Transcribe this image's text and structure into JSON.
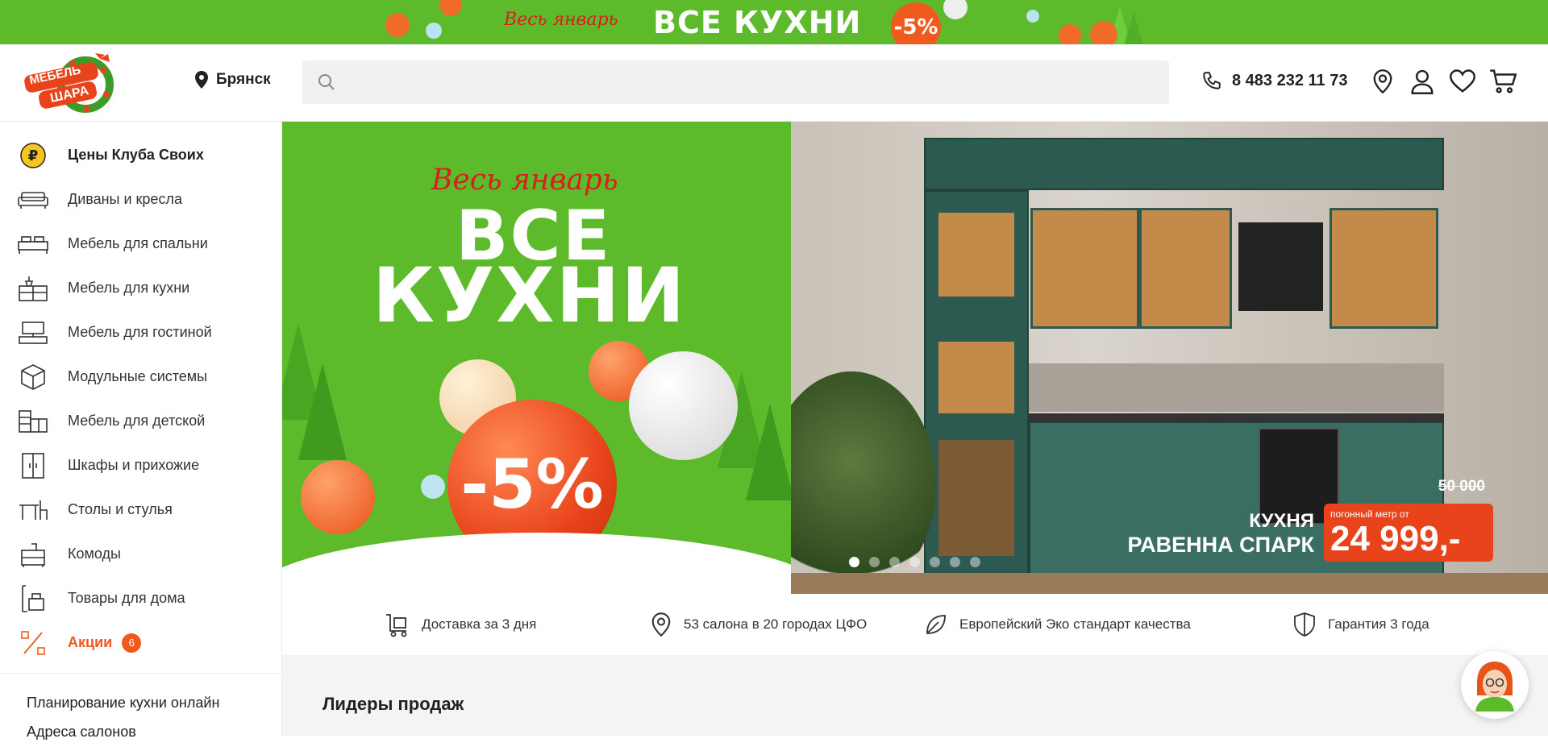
{
  "promo_banner": {
    "script_text": "Весь январь",
    "headline": "ВСЕ КУХНИ",
    "discount": "-5%"
  },
  "header": {
    "logo_text_line1": "МЕБЕЛЬ",
    "logo_text_line2": "ШАРА",
    "city": "Брянск",
    "search_placeholder": "",
    "phone": "8 483 232 11 73",
    "icons": [
      "phone-icon",
      "location-icon",
      "user-icon",
      "heart-icon",
      "cart-icon"
    ]
  },
  "sidebar": {
    "items": [
      {
        "label": "Цены Клуба Своих",
        "icon": "ruble-coin-icon"
      },
      {
        "label": "Диваны и кресла",
        "icon": "sofa-icon"
      },
      {
        "label": "Мебель для спальни",
        "icon": "bed-icon"
      },
      {
        "label": "Мебель для кухни",
        "icon": "kitchen-icon"
      },
      {
        "label": "Мебель для гостиной",
        "icon": "tv-stand-icon"
      },
      {
        "label": "Модульные системы",
        "icon": "cube-icon"
      },
      {
        "label": "Мебель для детской",
        "icon": "kids-furniture-icon"
      },
      {
        "label": "Шкафы и прихожие",
        "icon": "wardrobe-icon"
      },
      {
        "label": "Столы и стулья",
        "icon": "table-chair-icon"
      },
      {
        "label": "Комоды",
        "icon": "dresser-icon"
      },
      {
        "label": "Товары для дома",
        "icon": "home-goods-icon"
      },
      {
        "label": "Акции",
        "icon": "percent-icon",
        "badge": "6"
      }
    ],
    "links": [
      "Планирование кухни онлайн",
      "Адреса салонов"
    ]
  },
  "hero": {
    "left": {
      "script_text": "Весь январь",
      "line1": "ВСЕ",
      "line2": "КУХНИ",
      "discount": "-5%"
    },
    "right": {
      "kitchen_type": "КУХНЯ",
      "kitchen_name": "РАВЕННА СПАРК",
      "old_price": "50 000",
      "price_label": "погонный метр от",
      "price": "24 999,-"
    },
    "slides_count": 7,
    "active_slide": 0
  },
  "advantages": [
    {
      "text": "Доставка за 3 дня",
      "icon": "delivery-cart-icon"
    },
    {
      "text": "53 салона в 20 городах ЦФО",
      "icon": "location-pin-icon"
    },
    {
      "text": "Европейский Эко стандарт качества",
      "icon": "leaf-icon"
    },
    {
      "text": "Гарантия 3 года",
      "icon": "shield-icon"
    }
  ],
  "section_title": "Лидеры продаж",
  "colors": {
    "brand_green": "#5dbb2b",
    "accent_orange": "#f05a1f",
    "red_script": "#d8201f",
    "cabinet_green": "#2c5a50"
  }
}
